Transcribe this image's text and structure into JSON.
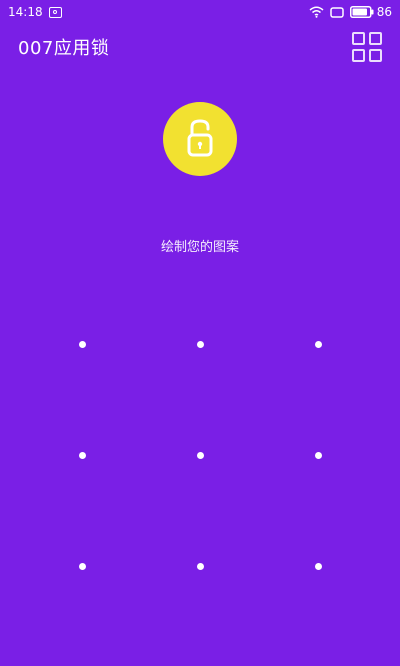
{
  "status_bar": {
    "time": "14:18",
    "battery_level": "86",
    "icons": [
      "notification-icon",
      "wifi-icon",
      "rotate-icon",
      "battery-icon"
    ]
  },
  "header": {
    "title": "007应用锁",
    "menu_icon": "grid-icon"
  },
  "lock_badge": {
    "icon": "unlock-icon",
    "color": "#f2e130"
  },
  "prompt": {
    "text": "绘制您的图案"
  },
  "pattern": {
    "rows": 3,
    "columns": 3
  },
  "colors": {
    "background": "#7a1fe6",
    "accent": "#f2e130",
    "text": "#ffffff"
  }
}
